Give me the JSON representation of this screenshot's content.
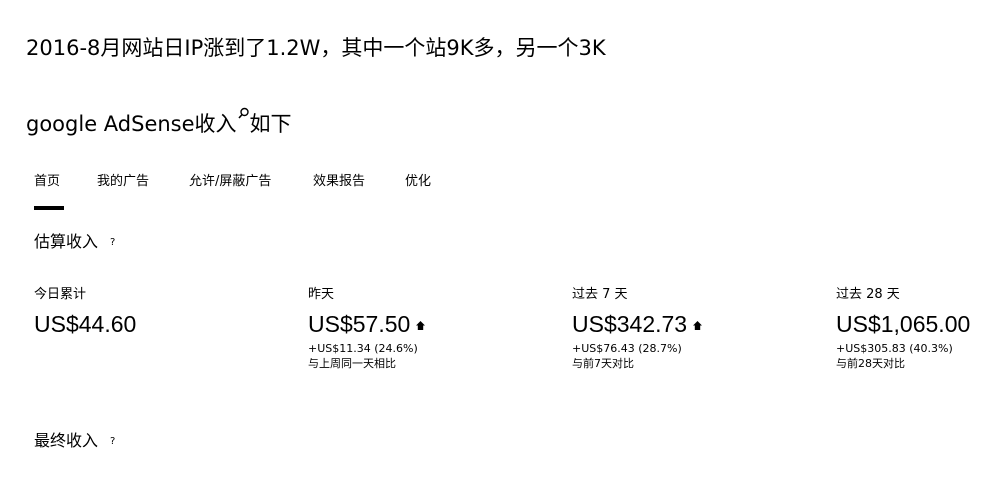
{
  "headline": {
    "line1": "2016-8月网站日IP涨到了1.2W，其中一个站9K多，另一个3K",
    "line2_before": "google AdSense收入",
    "line2_after": "如下"
  },
  "tabs": [
    {
      "label": "首页"
    },
    {
      "label": "我的广告"
    },
    {
      "label": "允许/屏蔽广告"
    },
    {
      "label": "效果报告"
    },
    {
      "label": "优化"
    }
  ],
  "estimated": {
    "title": "估算收入",
    "help": "?",
    "stats": [
      {
        "label": "今日累计",
        "value": "US$44.60",
        "change": "",
        "compare": ""
      },
      {
        "label": "昨天",
        "value": "US$57.50",
        "change": "+US$11.34 (24.6%)",
        "compare": "与上周同一天相比",
        "trend": "up"
      },
      {
        "label": "过去 7 天",
        "value": "US$342.73",
        "change": "+US$76.43 (28.7%)",
        "compare": "与前7天对比",
        "trend": "up"
      },
      {
        "label": "过去 28 天",
        "value": "US$1,065.00",
        "change": "+US$305.83 (40.3%)",
        "compare": "与前28天对比"
      }
    ]
  },
  "final": {
    "title": "最终收入",
    "help": "?"
  }
}
